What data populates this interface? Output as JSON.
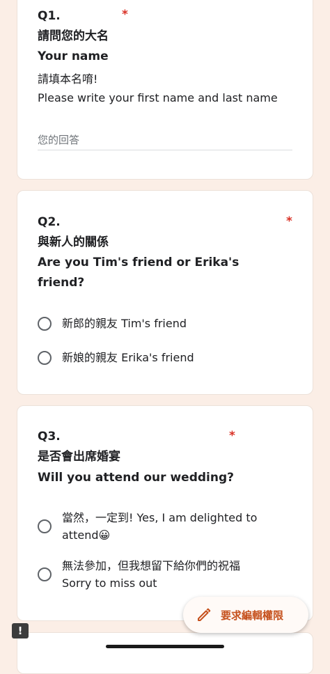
{
  "q1": {
    "number": "Q1.",
    "required_mark": "*",
    "title_zh": "請問您的大名",
    "title_en": "Your name",
    "desc_zh": "請填本名唷!",
    "desc_en": "Please write your first name and last name",
    "input_placeholder": "您的回答"
  },
  "q2": {
    "number": "Q2.",
    "required_mark": "*",
    "title_zh": "與新人的關係",
    "title_en_1": "Are you Tim's friend or Erika's",
    "title_en_2": "friend?",
    "options": [
      "新郎的親友 Tim's friend",
      "新娘的親友 Erika's friend"
    ]
  },
  "q3": {
    "number": "Q3.",
    "required_mark": "*",
    "title_zh": "是否會出席婚宴",
    "title_en": "Will you attend our wedding?",
    "option1_line1": "當然，一定到! Yes, I am delighted to",
    "option1_line2": "attend😀",
    "option2_line1": "無法參加，但我想留下給你們的祝福",
    "option2_line2": "Sorry to miss out"
  },
  "fab": {
    "label": "要求編輯權限",
    "icon": "pencil-icon",
    "accent": "#c5501c"
  },
  "report": {
    "symbol": "!"
  }
}
